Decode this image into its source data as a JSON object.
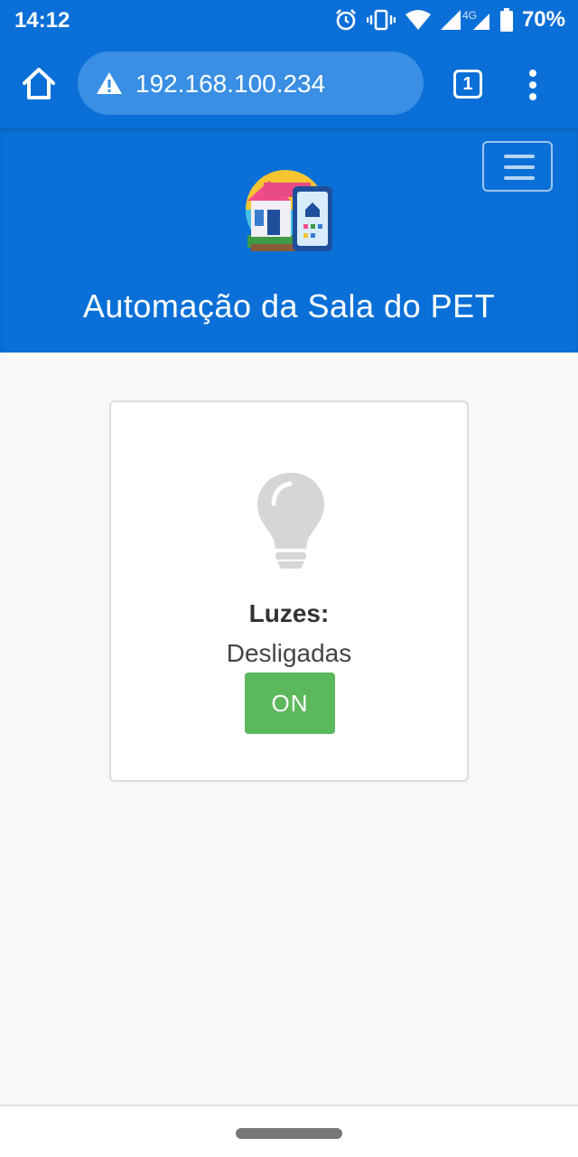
{
  "status_bar": {
    "time": "14:12",
    "network_label": "4G",
    "battery_percent": "70%",
    "icons": [
      "alarm-icon",
      "vibrate-icon",
      "wifi-icon",
      "signal-icon",
      "battery-icon"
    ]
  },
  "browser": {
    "url": "192.168.100.234",
    "tab_count": "1",
    "icons": [
      "home-icon",
      "warning-icon",
      "tabs-icon",
      "more-vert-icon"
    ]
  },
  "header": {
    "title": "Automação da Sala do PET",
    "menu_icon": "hamburger-icon",
    "logo": "smart-home-logo"
  },
  "device_card": {
    "label": "Luzes:",
    "status": "Desligadas",
    "button_label": "ON",
    "icon": "lightbulb-icon"
  },
  "colors": {
    "primary": "#0a70d8",
    "url_box": "#3a8fe4",
    "button_green": "#5cb85c",
    "bulb_off": "#d6d6d6",
    "background": "#f8f8f8"
  }
}
